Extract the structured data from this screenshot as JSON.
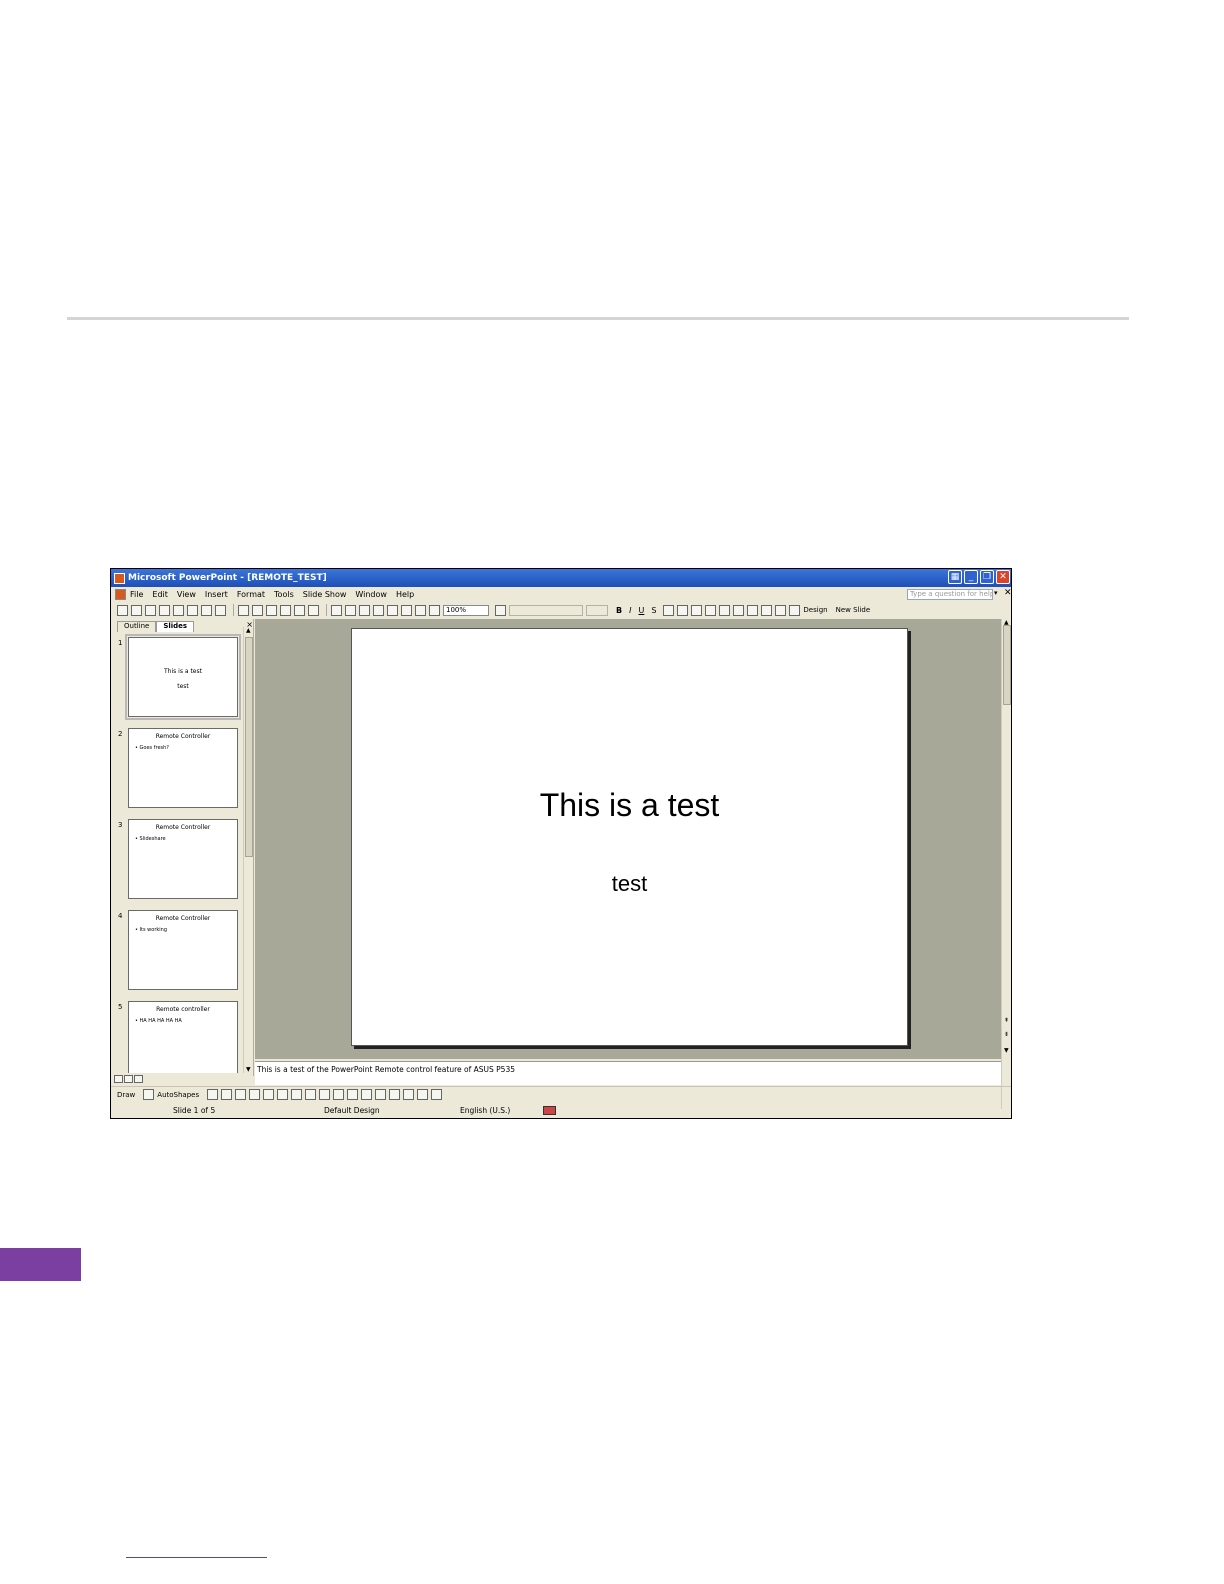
{
  "window": {
    "title": "Microsoft PowerPoint - [REMOTE_TEST]"
  },
  "menu": {
    "items": [
      "File",
      "Edit",
      "View",
      "Insert",
      "Format",
      "Tools",
      "Slide Show",
      "Window",
      "Help"
    ],
    "help_placeholder": "Type a question for help"
  },
  "toolbar": {
    "zoom": "100%",
    "bold": "B",
    "italic": "I",
    "underline": "U",
    "shadow": "S",
    "design_label": "Design",
    "new_slide_label": "New Slide"
  },
  "pane": {
    "tabs": [
      "Outline",
      "Slides"
    ],
    "close": "×"
  },
  "thumbnails": [
    {
      "num": "1",
      "title": "This is a test",
      "sub": "test"
    },
    {
      "num": "2",
      "title": "Remote Controller",
      "bullet": "• Goes fresh?"
    },
    {
      "num": "3",
      "title": "Remote Controller",
      "bullet": "• Slideshare"
    },
    {
      "num": "4",
      "title": "Remote Controller",
      "bullet": "• Its working"
    },
    {
      "num": "5",
      "title": "Remote controller",
      "bullet": "• HA HA HA HA HA"
    }
  ],
  "slide": {
    "title": "This is a test",
    "subtitle": "test"
  },
  "notes": {
    "text": "This is a test of the PowerPoint Remote control feature of ASUS P535"
  },
  "drawing": {
    "draw_label": "Draw",
    "autoshapes_label": "AutoShapes"
  },
  "status": {
    "slide": "Slide 1 of 5",
    "design": "Default Design",
    "language": "English (U.S.)"
  },
  "colors": {
    "titlebar": "#1f4fb8",
    "chrome": "#ece9d8",
    "canvas": "#a8a898",
    "purple_tab": "#7a3fa0"
  }
}
